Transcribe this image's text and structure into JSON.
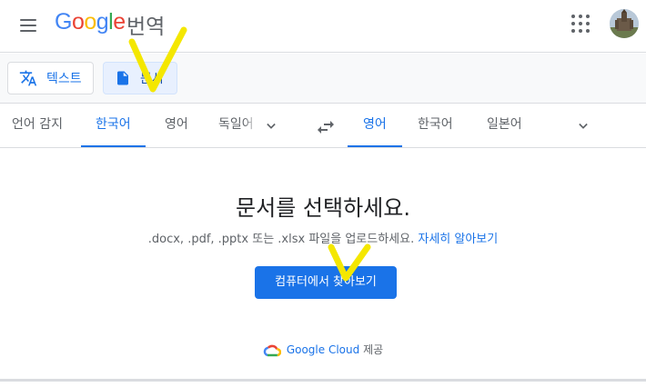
{
  "header": {
    "logo": [
      "G",
      "o",
      "o",
      "g",
      "l",
      "e"
    ],
    "product_title": "번역",
    "menu_icon": "hamburger-menu-icon",
    "apps_icon": "apps-grid-icon"
  },
  "modes": {
    "text_label": "텍스트",
    "document_label": "문서"
  },
  "languages": {
    "source": [
      "언어 감지",
      "한국어",
      "영어",
      "독일어"
    ],
    "source_active": "한국어",
    "target": [
      "영어",
      "한국어",
      "일본어"
    ],
    "target_active": "영어"
  },
  "main": {
    "heading": "문서를 선택하세요.",
    "description": ".docx, .pdf, .pptx 또는 .xlsx 파일을 업로드하세요.",
    "learn_more": "자세히 알아보기",
    "browse_button": "컴퓨터에서 찾아보기",
    "cloud_brand": "Google Cloud",
    "cloud_suffix": "제공"
  },
  "colors": {
    "accent": "#1a73e8",
    "annotation": "#f4e700"
  }
}
